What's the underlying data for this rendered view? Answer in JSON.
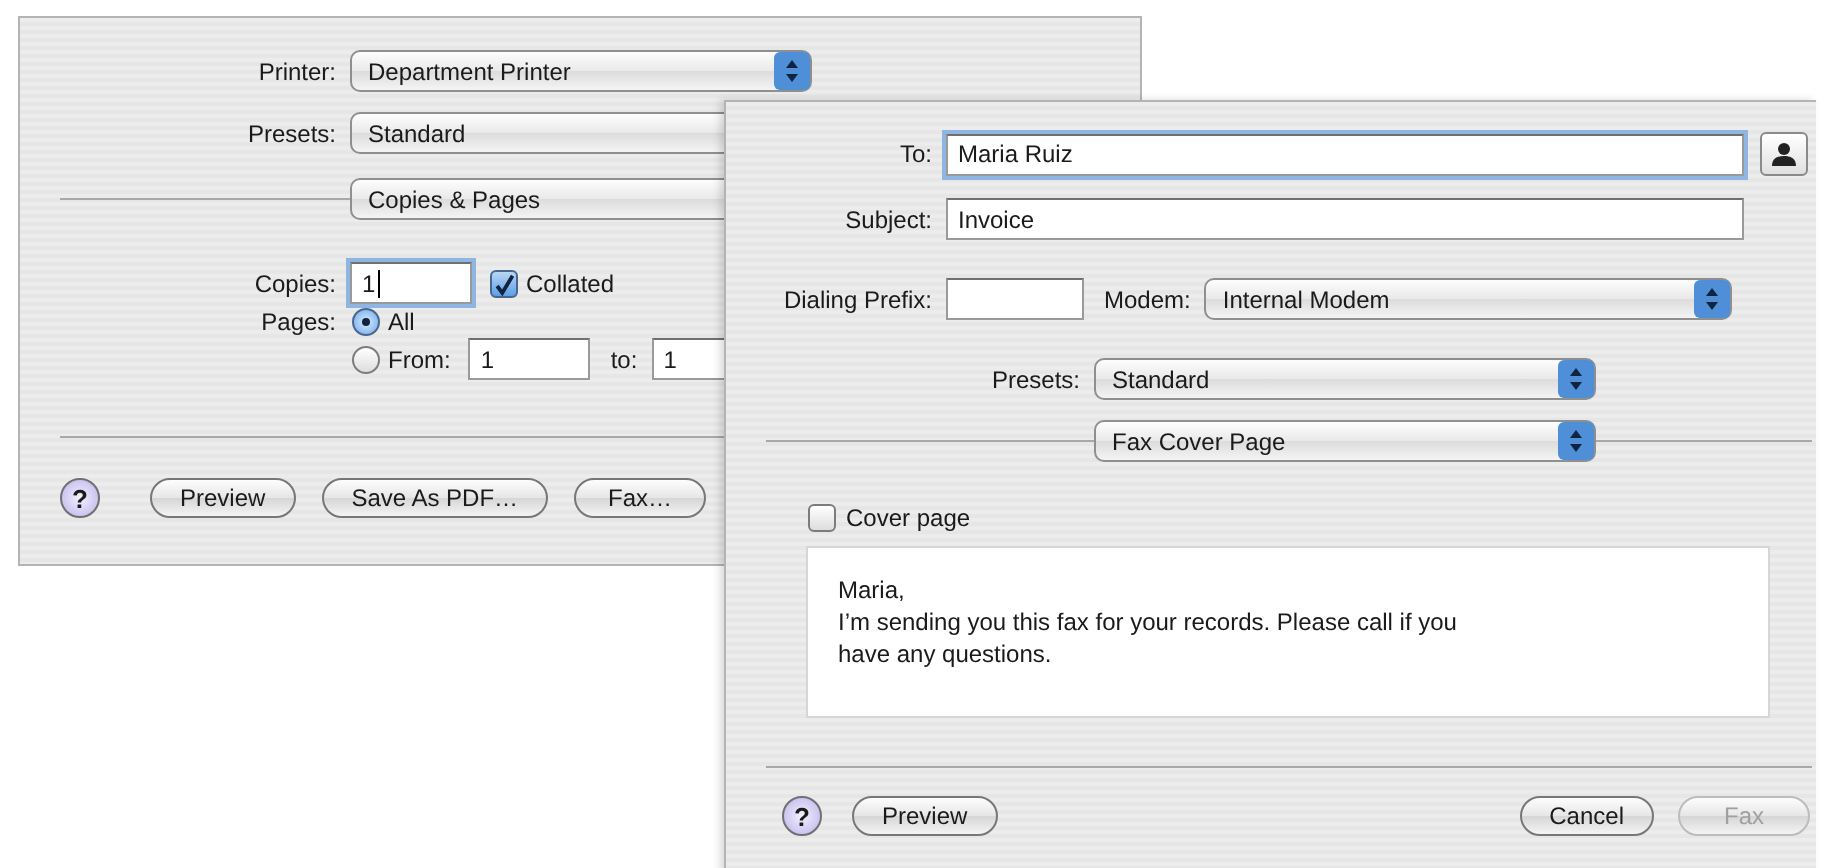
{
  "print_dialog": {
    "printer": {
      "label": "Printer:",
      "value": "Department Printer"
    },
    "presets": {
      "label": "Presets:",
      "value": "Standard"
    },
    "panel": {
      "value": "Copies & Pages"
    },
    "copies": {
      "label": "Copies:",
      "value": "1",
      "focused": true
    },
    "collated": {
      "label": "Collated",
      "checked": true
    },
    "pages": {
      "label": "Pages:",
      "options": [
        {
          "label": "All",
          "selected": true
        },
        {
          "label": "From:",
          "selected": false
        }
      ],
      "from": {
        "value": "1",
        "focused": false
      },
      "to_label": "to:",
      "to": {
        "value": "1",
        "focused": false
      }
    },
    "buttons": [
      {
        "kind": "help",
        "label": "?"
      },
      {
        "kind": "push",
        "label": "Preview",
        "disabled": false
      },
      {
        "kind": "push",
        "label": "Save As PDF…",
        "disabled": false
      },
      {
        "kind": "push",
        "label": "Fax…",
        "disabled": false
      }
    ]
  },
  "fax_dialog": {
    "to": {
      "label": "To:",
      "value": "Maria Ruiz",
      "focused": true
    },
    "subject": {
      "label": "Subject:",
      "value": "Invoice",
      "focused": false
    },
    "dialing_prefix": {
      "label": "Dialing Prefix:",
      "focused": false
    },
    "modem": {
      "label": "Modem:",
      "value": "Internal Modem"
    },
    "presets": {
      "label": "Presets:",
      "value": "Standard"
    },
    "panel": {
      "value": "Fax Cover Page"
    },
    "cover_page": {
      "label": "Cover page",
      "checked": false
    },
    "message": "Maria,\nI’m sending you this fax for your records. Please call if you\nhave any questions.",
    "buttons": [
      {
        "kind": "help",
        "label": "?"
      },
      {
        "kind": "push",
        "label": "Preview",
        "disabled": false
      },
      {
        "kind": "spacer"
      },
      {
        "kind": "push",
        "label": "Cancel",
        "disabled": false
      },
      {
        "kind": "push",
        "label": "Fax",
        "disabled": true
      }
    ]
  }
}
